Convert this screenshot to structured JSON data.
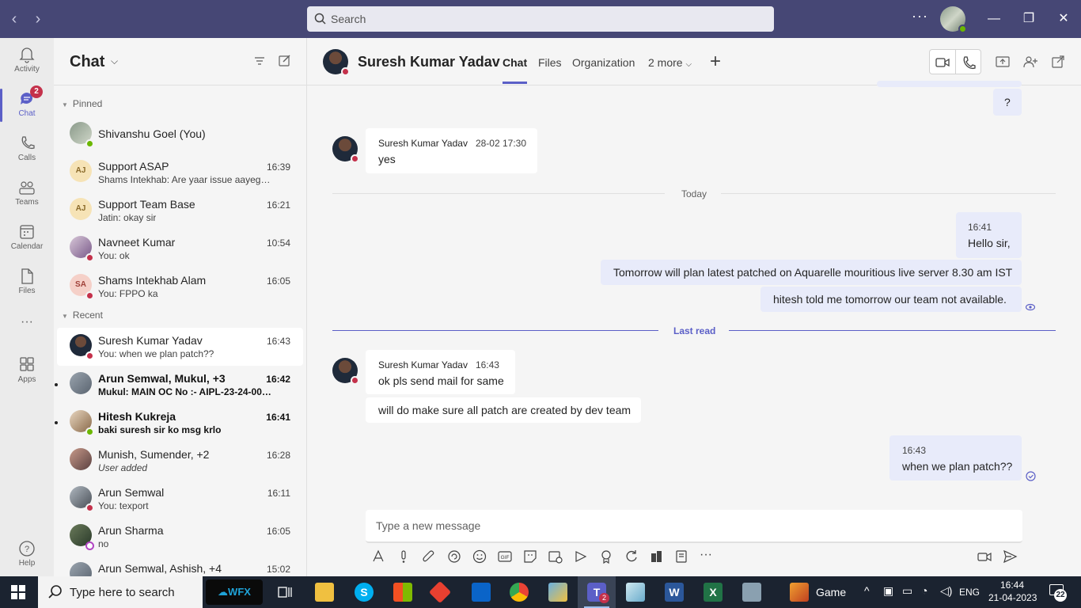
{
  "titlebar": {
    "search_placeholder": "Search",
    "more": "···"
  },
  "rail": {
    "activity": "Activity",
    "chat": "Chat",
    "chat_badge": "2",
    "calls": "Calls",
    "teams": "Teams",
    "calendar": "Calendar",
    "files": "Files",
    "more": "···",
    "apps": "Apps",
    "help": "Help"
  },
  "chatlist": {
    "title": "Chat",
    "pinned_label": "Pinned",
    "recent_label": "Recent",
    "pinned": [
      {
        "name": "Shivanshu Goel (You)",
        "preview": "",
        "time": ""
      },
      {
        "name": "Support ASAP",
        "preview": "Shams Intekhab: Are yaar issue aayega t...",
        "time": "16:39",
        "initials": "AJ"
      },
      {
        "name": "Support Team Base",
        "preview": "Jatin: okay sir",
        "time": "16:21",
        "initials": "AJ"
      },
      {
        "name": "Navneet Kumar",
        "preview": "You: ok",
        "time": "10:54"
      },
      {
        "name": "Shams Intekhab Alam",
        "preview": "You: FPPO ka",
        "time": "16:05",
        "initials": "SA"
      }
    ],
    "recent": [
      {
        "name": "Suresh Kumar Yadav",
        "preview": "You: when we plan patch??",
        "time": "16:43"
      },
      {
        "name": "Arun Semwal, Mukul, +3",
        "preview": "Mukul: MAIN OC No :- AIPL-23-24-000...",
        "time": "16:42"
      },
      {
        "name": "Hitesh Kukreja",
        "preview": "baki suresh sir ko msg krlo",
        "time": "16:41"
      },
      {
        "name": "Munish, Sumender, +2",
        "preview": "User added",
        "time": "16:28"
      },
      {
        "name": "Arun Semwal",
        "preview": "You: texport",
        "time": "16:11"
      },
      {
        "name": "Arun Sharma",
        "preview": "no",
        "time": "16:05"
      },
      {
        "name": "Arun Semwal, Ashish, +4",
        "preview": "",
        "time": "15:02"
      }
    ]
  },
  "conversation": {
    "contact": "Suresh Kumar Yadav",
    "tabs": [
      "Chat",
      "Files",
      "Organization",
      "2 more"
    ],
    "messages": {
      "q_mark": "?",
      "m1_author": "Suresh Kumar Yadav",
      "m1_time": "28-02 17:30",
      "m1_text": "yes",
      "today": "Today",
      "m2_time": "16:41",
      "m2_text": "Hello sir,",
      "m3_text": "Tomorrow will plan latest patched on Aquarelle mouritious live server 8.30 am IST",
      "m4_text": "hitesh told me tomorrow our team not available.",
      "last_read": "Last read",
      "m5_author": "Suresh Kumar Yadav",
      "m5_time": "16:43",
      "m5_text": "ok pls send mail for same",
      "m6_text": "will do make sure all patch are created by dev team",
      "m7_time": "16:43",
      "m7_text": "when we plan patch??"
    },
    "compose_placeholder": "Type a new message"
  },
  "taskbar": {
    "search_placeholder": "Type here to search",
    "wfx": "WFX",
    "game": "Game",
    "lang": "ENG",
    "time": "16:44",
    "date": "21-04-2023",
    "notif_count": "22",
    "teams_badge": "2"
  }
}
